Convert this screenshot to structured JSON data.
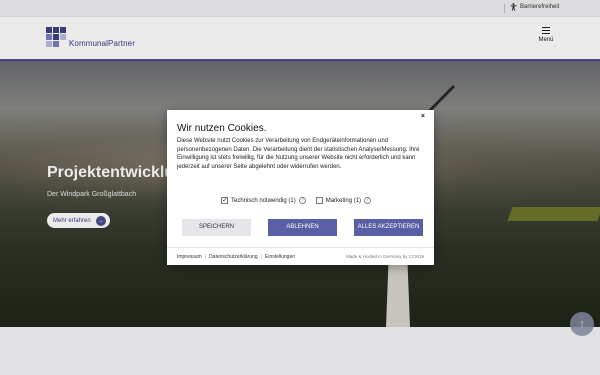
{
  "topbar": {
    "accessibility_label": "Barrierefreiheit"
  },
  "header": {
    "logo_text": "KommunalPartner",
    "menu_label": "Menü",
    "logo_colors": [
      "#3d4185",
      "#7a7fc0",
      "#b9bce0"
    ]
  },
  "hero": {
    "title": "Projektentwicklu",
    "subtitle": "Der Windpark Großglattbach",
    "button_label": "Mehr erfahren",
    "button_arrow": "→"
  },
  "scroll_top_icon": "↑",
  "cookie": {
    "close": "×",
    "title": "Wir nutzen Cookies.",
    "body": "Diese Website nutzt Cookies zur Verarbeitung von Endgeräteinformationen und personenbezogenen Daten. Die Verarbeitung dient der statistischen Analyse/Messung. Ihre Einwilligung ist stets freiwillig, für die Nutzung unserer Website nicht erforderlich und kann jederzeit auf unserer Seite abgelehnt oder widerrufen werden.",
    "options": [
      {
        "label": "Technisch notwendig (1)",
        "checked": true
      },
      {
        "label": "Marketing (1)",
        "checked": false
      }
    ],
    "help_icon": "?",
    "buttons": {
      "save": "SPEICHERN",
      "deny": "ABLEHNEN",
      "accept_all": "ALLES AKZEPTIEREN"
    },
    "footer_links": [
      "Impressum",
      "Datenschutzerklärung",
      "Einstellungen"
    ],
    "made_hosted": "Made & Hosted in Germany by CCM19"
  },
  "colors": {
    "brand": "#4a4f8f",
    "button": "#5a5fa5"
  }
}
